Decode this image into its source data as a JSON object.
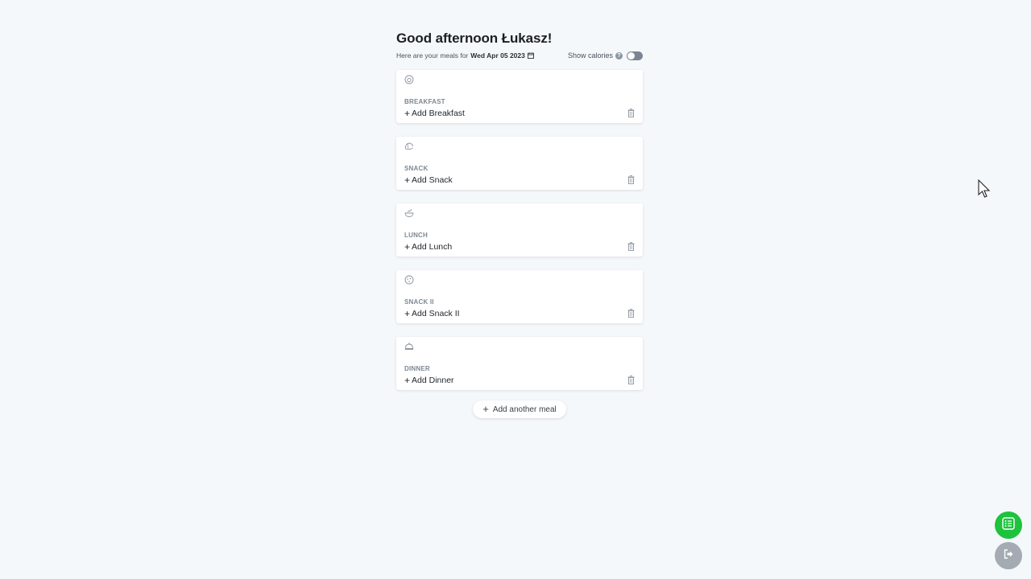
{
  "header": {
    "greeting": "Good afternoon Łukasz!",
    "subtitle_prefix": "Here are your meals for",
    "date": "Wed Apr 05 2023",
    "show_calories_label": "Show calories",
    "show_calories_enabled": false,
    "help_glyph": "?"
  },
  "meals": [
    {
      "label": "BREAKFAST",
      "add_text": "Add Breakfast",
      "icon": "egg-icon"
    },
    {
      "label": "SNACK",
      "add_text": "Add Snack",
      "icon": "croissant-icon"
    },
    {
      "label": "LUNCH",
      "add_text": "Add Lunch",
      "icon": "bowl-icon"
    },
    {
      "label": "SNACK II",
      "add_text": "Add Snack II",
      "icon": "cookie-icon"
    },
    {
      "label": "DINNER",
      "add_text": "Add Dinner",
      "icon": "cloche-icon"
    }
  ],
  "add_meal_button": "Add another meal",
  "colors": {
    "background": "#f5f8fb",
    "fab_green": "#1ec23d",
    "fab_gray": "#a4abb3",
    "toggle_off": "#7b8591"
  },
  "fabs": [
    {
      "icon": "shopping-list-icon"
    },
    {
      "icon": "logout-icon"
    }
  ]
}
